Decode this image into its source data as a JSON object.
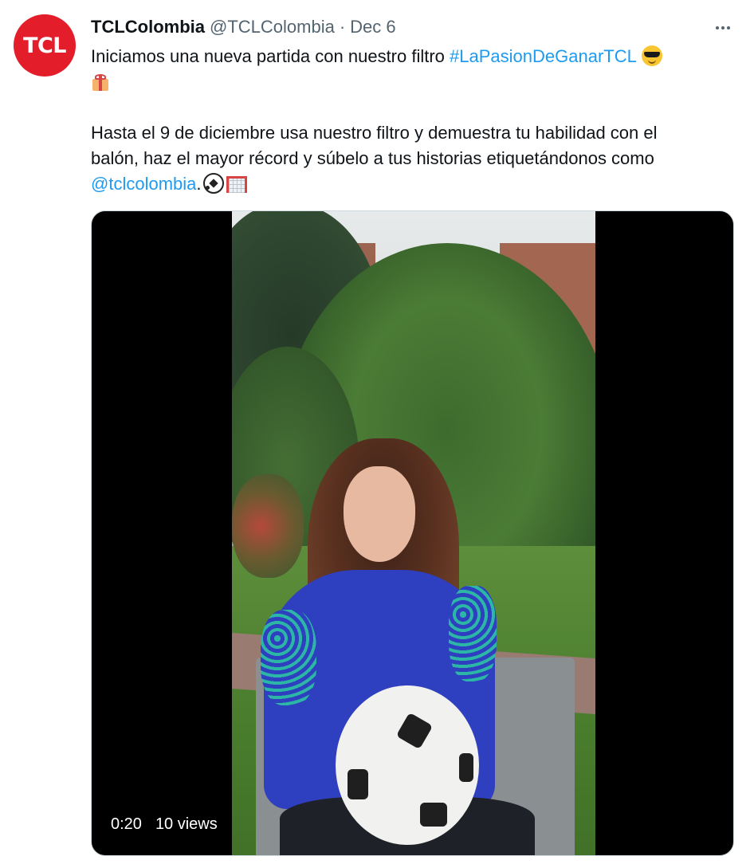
{
  "tweet": {
    "avatar": {
      "text": "TCL",
      "color": "#e31d2a"
    },
    "display_name": "TCLColombia",
    "handle": "@TCLColombia",
    "separator": "·",
    "date": "Dec 6",
    "more_icon": "more-horizontal-icon",
    "body": {
      "line1_text": "Iniciamos una nueva partida con nuestro filtro ",
      "hashtag": "#LaPasionDeGanarTCL",
      "line1_emoji": "smiling-face-with-sunglasses",
      "line2_emoji": "wrapped-gift",
      "paragraph2_line1": "Hasta el 9 de diciembre usa nuestro filtro y demuestra tu habilidad con el",
      "paragraph2_line2": "balón, haz el mayor récord y súbelo a tus historias etiquetándonos como",
      "mention": "@tclcolombia",
      "mention_suffix": ".",
      "end_emojis": [
        "soccer-ball",
        "goal-net"
      ]
    },
    "media": {
      "type": "video",
      "time": "0:20",
      "views": "10 views"
    },
    "colors": {
      "text": "#0f1419",
      "secondary": "#536471",
      "link": "#1d9bf0"
    }
  }
}
